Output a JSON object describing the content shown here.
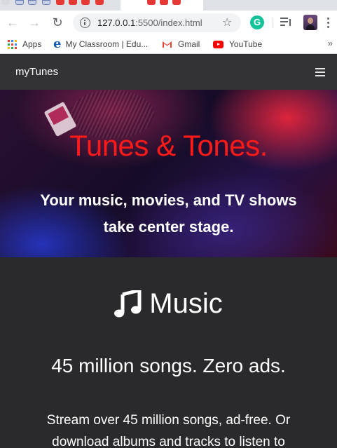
{
  "browser": {
    "url_host": "127.0.0.1",
    "url_rest": ":5500/index.html",
    "extension_letter": "G",
    "bookmarks": [
      {
        "label": "Apps"
      },
      {
        "label": "My Classroom | Edu..."
      },
      {
        "label": "Gmail"
      },
      {
        "label": "YouTube"
      }
    ],
    "more_bookmarks": "»"
  },
  "navbar": {
    "brand": "myTunes"
  },
  "hero": {
    "title": "Tunes & Tones.",
    "subtitle_line1": "Your music, movies, and TV shows",
    "subtitle_line2": "take center stage."
  },
  "music": {
    "heading": "Music",
    "tagline": "45 million songs. Zero ads.",
    "description_line1": "Stream over 45 million songs, ad-free. Or",
    "description_line2": "download albums and tracks to listen to"
  },
  "colors": {
    "hero_title": "#ff1a1a",
    "navbar_bg": "#333335",
    "section_bg": "#2a2a2c",
    "youtube_red": "#ff0000",
    "grammarly_green": "#15c39a"
  }
}
